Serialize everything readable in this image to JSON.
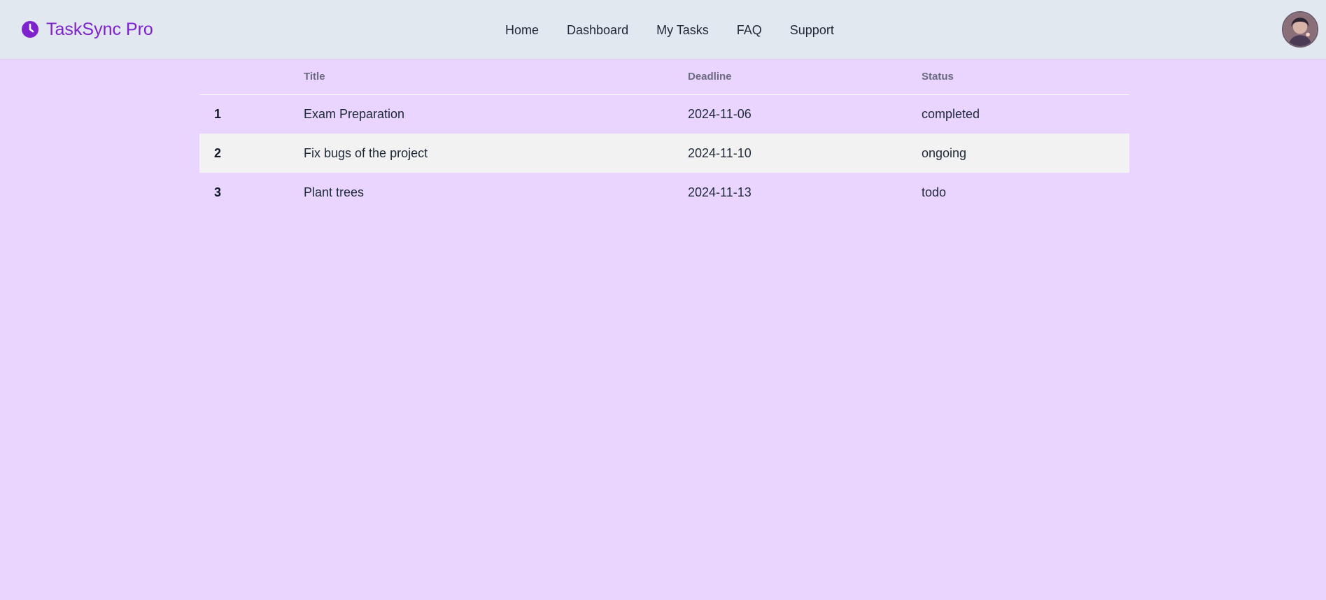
{
  "app": {
    "brand": "TaskSync Pro",
    "brand_color": "#7e22ce",
    "brand_icon": "clock-icon"
  },
  "nav": {
    "items": [
      {
        "label": "Home"
      },
      {
        "label": "Dashboard"
      },
      {
        "label": "My Tasks"
      },
      {
        "label": "FAQ"
      },
      {
        "label": "Support"
      }
    ]
  },
  "user": {
    "avatar_icon": "user-avatar"
  },
  "table": {
    "headers": {
      "num": "",
      "title": "Title",
      "deadline": "Deadline",
      "status": "Status"
    },
    "rows": [
      {
        "num": "1",
        "title": "Exam Preparation",
        "deadline": "2024-11-06",
        "status": "completed"
      },
      {
        "num": "2",
        "title": "Fix bugs of the project",
        "deadline": "2024-11-10",
        "status": "ongoing"
      },
      {
        "num": "3",
        "title": "Plant trees",
        "deadline": "2024-11-13",
        "status": "todo"
      }
    ]
  },
  "colors": {
    "page_background": "#e9d5ff",
    "navbar_background": "#e2e8f0",
    "zebra_row": "#f2f2f2"
  }
}
